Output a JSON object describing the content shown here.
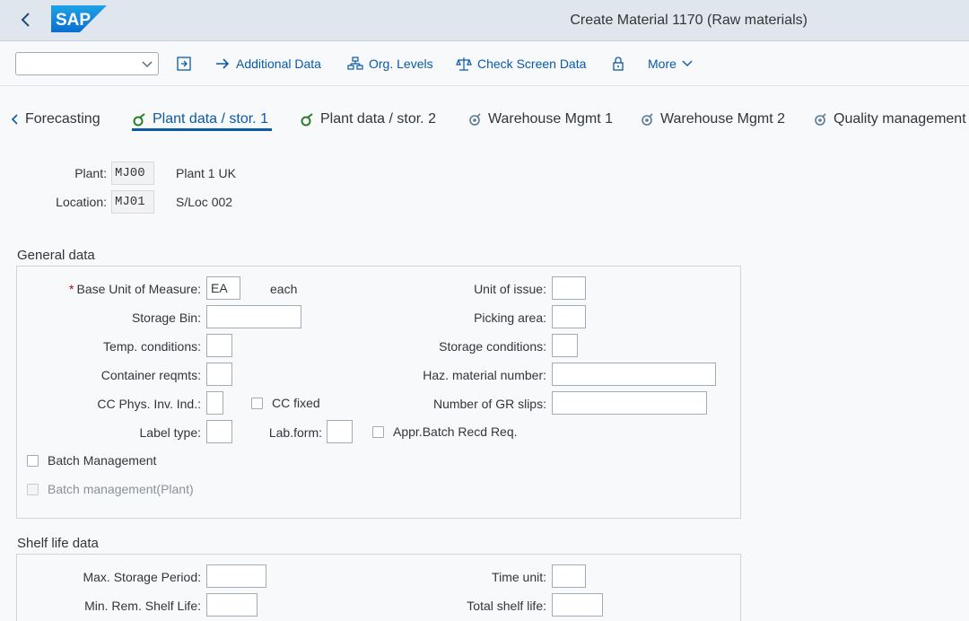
{
  "shell": {
    "title": "Create Material 1170 (Raw materials)",
    "logo_text": "SAP"
  },
  "toolbar": {
    "dropdown_value": "",
    "additional_data": "Additional Data",
    "org_levels": "Org. Levels",
    "check_screen_data": "Check Screen Data",
    "more": "More"
  },
  "tabs": {
    "forecasting": "Forecasting",
    "plant_stor_1": "Plant data / stor. 1",
    "plant_stor_2": "Plant data / stor. 2",
    "warehouse_1": "Warehouse Mgmt 1",
    "warehouse_2": "Warehouse Mgmt 2",
    "quality": "Quality management"
  },
  "header": {
    "plant_label": "Plant:",
    "plant_value": "MJ00",
    "plant_desc": "Plant 1 UK",
    "location_label": "Location:",
    "location_value": "MJ01",
    "location_desc": "S/Loc 002"
  },
  "general": {
    "title": "General data",
    "base_uom_label": "Base Unit of Measure:",
    "base_uom_value": "EA",
    "base_uom_desc": "each",
    "storage_bin_label": "Storage Bin:",
    "temp_conditions_label": "Temp. conditions:",
    "container_reqmts_label": "Container reqmts:",
    "cc_phys_label": "CC Phys. Inv. Ind.:",
    "cc_fixed_label": "CC fixed",
    "label_type_label": "Label type:",
    "lab_form_label": "Lab.form:",
    "appr_batch_label": "Appr.Batch Recd Req.",
    "batch_mgmt_label": "Batch Management",
    "batch_mgmt_plant_label": "Batch management(Plant)",
    "unit_of_issue_label": "Unit of issue:",
    "picking_area_label": "Picking area:",
    "storage_conditions_label": "Storage conditions:",
    "haz_material_label": "Haz. material number:",
    "gr_slips_label": "Number of GR slips:"
  },
  "shelf": {
    "title": "Shelf life data",
    "max_storage_label": "Max. Storage Period:",
    "min_rem_label": "Min. Rem. Shelf Life:",
    "time_unit_label": "Time unit:",
    "total_shelf_label": "Total shelf life:"
  },
  "colors": {
    "accent": "#0a5aa4",
    "shell_bg": "#dfe6ee",
    "required": "#bb0000"
  }
}
